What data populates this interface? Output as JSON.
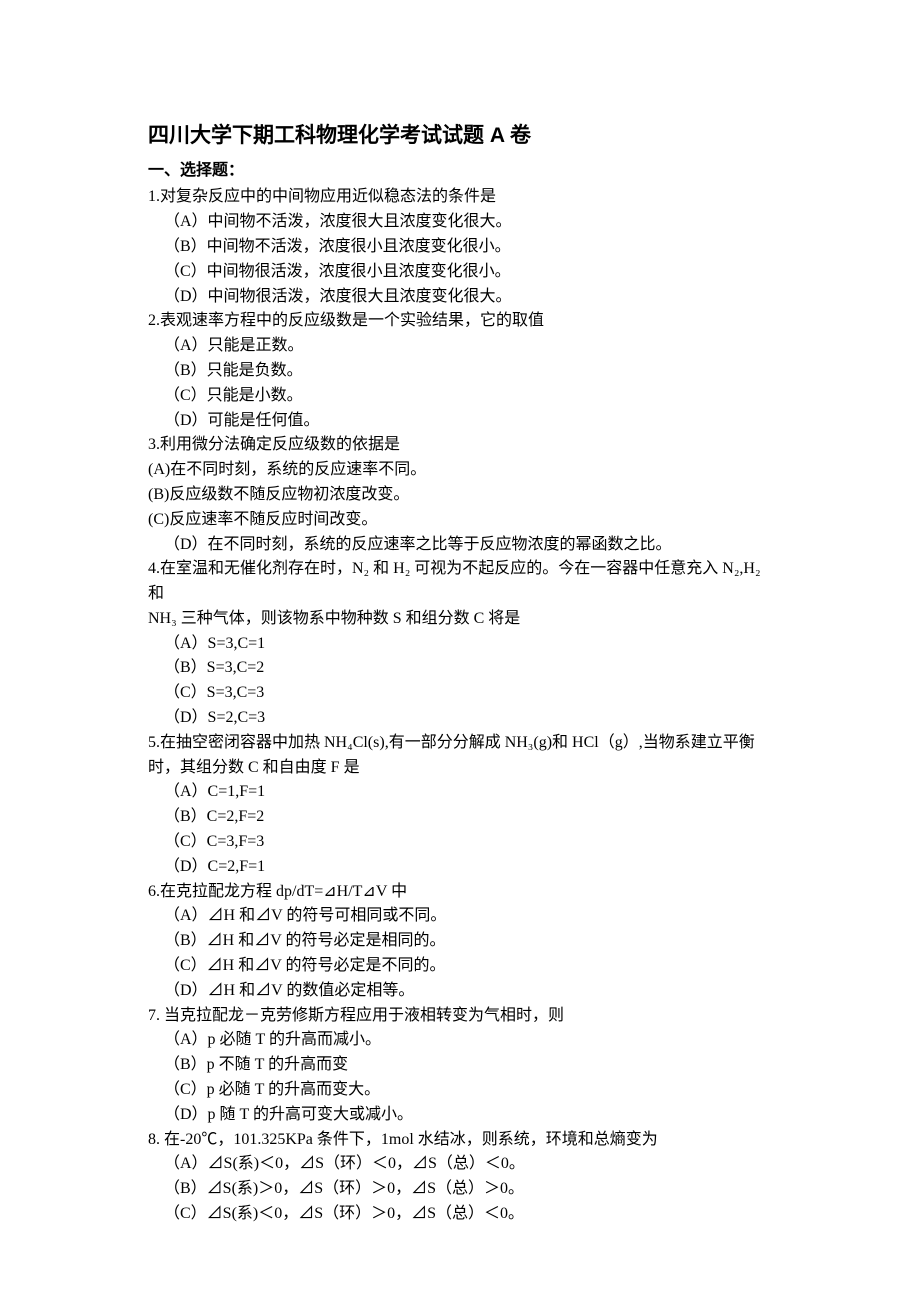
{
  "title": "四川大学下期工科物理化学考试试题 A 卷",
  "section1_heading": "一、选择题：",
  "q1": {
    "stem": "1.对复杂反应中的中间物应用近似稳态法的条件是",
    "A": "（A）中间物不活泼，浓度很大且浓度变化很大。",
    "B": "（B）中间物不活泼，浓度很小且浓度变化很小。",
    "C": "（C）中间物很活泼，浓度很小且浓度变化很小。",
    "D": "（D）中间物很活泼，浓度很大且浓度变化很大。"
  },
  "q2": {
    "stem": "2.表观速率方程中的反应级数是一个实验结果，它的取值",
    "A": "（A）只能是正数。",
    "B": "（B）只能是负数。",
    "C": "（C）只能是小数。",
    "D": "（D）可能是任何值。"
  },
  "q3": {
    "stem": "3.利用微分法确定反应级数的依据是",
    "A": "(A)在不同时刻，系统的反应速率不同。",
    "B": "(B)反应级数不随反应物初浓度改变。",
    "C": "(C)反应速率不随反应时间改变。",
    "D": "（D）在不同时刻，系统的反应速率之比等于反应物浓度的幂函数之比。"
  },
  "q4": {
    "stem1": "4.在室温和无催化剂存在时，N₂ 和 H₂ 可视为不起反应的。今在一容器中任意充入 N₂,H₂ 和",
    "stem2": "NH₃ 三种气体，则该物系中物种数 S 和组分数 C 将是",
    "A": "（A）S=3,C=1",
    "B": "（B）S=3,C=2",
    "C": "（C）S=3,C=3",
    "D": "（D）S=2,C=3"
  },
  "q5": {
    "stem1": "5.在抽空密闭容器中加热 NH₄Cl(s),有一部分分解成 NH₃(g)和 HCl（g）,当物系建立平衡",
    "stem2": "时，其组分数 C 和自由度 F 是",
    "A": "（A）C=1,F=1",
    "B": "（B）C=2,F=2",
    "C": "（C）C=3,F=3",
    "D": "（D）C=2,F=1"
  },
  "q6": {
    "stem": "6.在克拉配龙方程 dp/dT=⊿H/T⊿V 中",
    "A": "（A）⊿H 和⊿V 的符号可相同或不同。",
    "B": "（B）⊿H 和⊿V 的符号必定是相同的。",
    "C": "（C）⊿H 和⊿V 的符号必定是不同的。",
    "D": "（D）⊿H 和⊿V 的数值必定相等。"
  },
  "q7": {
    "stem": "7. 当克拉配龙－克劳修斯方程应用于液相转变为气相时，则",
    "A": "（A）p 必随 T 的升高而减小。",
    "B": "（B）p 不随 T 的升高而变",
    "C": "（C）p 必随 T 的升高而变大。",
    "D": "（D）p 随 T 的升高可变大或减小。"
  },
  "q8": {
    "stem": "8. 在-20℃，101.325KPa 条件下，1mol 水结冰，则系统，环境和总熵变为",
    "A": "（A）⊿S(系)＜0，⊿S（环）＜0，⊿S（总）＜0。",
    "B": "（B）⊿S(系)＞0，⊿S（环）＞0，⊿S（总）＞0。",
    "C": "（C）⊿S(系)＜0，⊿S（环）＞0，⊿S（总）＜0。"
  }
}
